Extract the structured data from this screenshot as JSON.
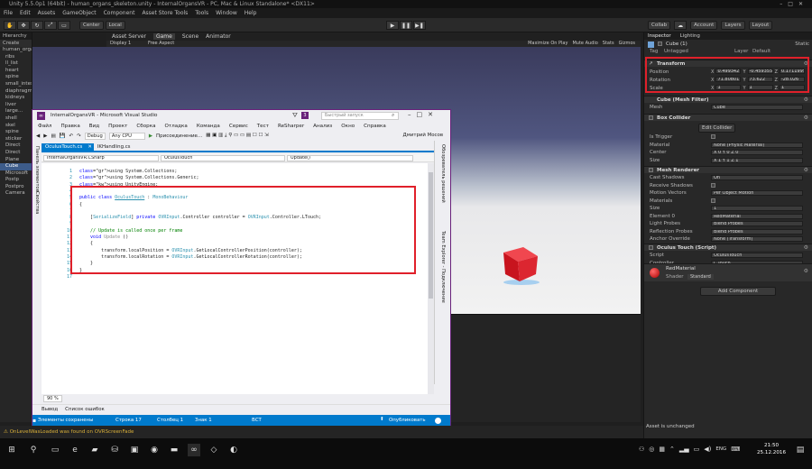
{
  "unity": {
    "title": "Unity 5.5.0p1 (64bit) - human_organs_skeleton.unity - InternalOrgansVR - PC, Mac & Linux Standalone* <DX11>",
    "menu": [
      "File",
      "Edit",
      "Assets",
      "GameObject",
      "Component",
      "Asset Store Tools",
      "Tools",
      "Window",
      "Help"
    ],
    "toolbar": {
      "pivot": "Center",
      "space": "Local",
      "collab": "Collab",
      "account": "Account",
      "layers": "Layers",
      "layout": "Layout"
    },
    "hierarchy": {
      "tab": "Hierarchy",
      "create": "Create",
      "items": [
        "human_organs_skeleton*",
        "ribs",
        "ll_list",
        "heart",
        "spine",
        "small_intestine",
        "diaphragm",
        "kidneys",
        "liver",
        "large...",
        "shell",
        "skel",
        "spine",
        "sticker",
        "Direct",
        "Direct",
        "Plane",
        "Cube",
        "Microsoft",
        "Postp",
        "Postpro",
        "Camera"
      ],
      "selected_index": 17
    },
    "scene_tabs": [
      "Asset Server",
      "Game",
      "Scene",
      "Animator"
    ],
    "scene_bar": {
      "display": "Display 1",
      "aspect": "Free Aspect",
      "right": [
        "Maximize On Play",
        "Mute Audio",
        "Stats",
        "Gizmos"
      ]
    },
    "inspector": {
      "tabs": [
        "Inspector",
        "Lighting"
      ],
      "object_name": "Cube (1)",
      "static_label": "Static",
      "tag_label": "Tag",
      "tag_value": "Untagged",
      "layer_label": "Layer",
      "layer_value": "Default",
      "transform": {
        "header": "Transform",
        "position_label": "Position",
        "position": {
          "x": "0.4993427",
          "y": "-0.4593557",
          "z": "0.1711995"
        },
        "rotation_label": "Rotation",
        "rotation": {
          "x": "71.80801",
          "y": "73.622",
          "z": "-28.026"
        },
        "scale_label": "Scale",
        "scale": {
          "x": "1",
          "y": "1",
          "z": "1"
        }
      },
      "mesh_filter": {
        "header": "Cube (Mesh Filter)",
        "mesh_label": "Mesh",
        "mesh_value": "Cube"
      },
      "box_collider": {
        "header": "Box Collider",
        "edit_button": "Edit Collider",
        "rows": [
          {
            "label": "Is Trigger",
            "value": ""
          },
          {
            "label": "Material",
            "value": "None (Physic Material)"
          },
          {
            "label": "Center",
            "value": "X 0   Y 0   Z 0"
          },
          {
            "label": "Size",
            "value": "X 1   Y 1   Z 1"
          }
        ]
      },
      "mesh_renderer": {
        "header": "Mesh Renderer",
        "rows": [
          {
            "label": "Cast Shadows",
            "value": "On"
          },
          {
            "label": "Receive Shadows",
            "value": ""
          },
          {
            "label": "Motion Vectors",
            "value": "Per Object Motion"
          },
          {
            "label": "Materials",
            "value": ""
          },
          {
            "label": "Size",
            "value": "1"
          },
          {
            "label": "Element 0",
            "value": "RedMaterial"
          },
          {
            "label": "Light Probes",
            "value": "Blend Probes"
          },
          {
            "label": "Reflection Probes",
            "value": "Blend Probes"
          },
          {
            "label": "Anchor Override",
            "value": "None (Transform)"
          }
        ]
      },
      "script": {
        "header": "Oculus Touch (Script)",
        "rows": [
          {
            "label": "Script",
            "value": "OculusTouch"
          },
          {
            "label": "Controller",
            "value": "L Touch"
          }
        ]
      },
      "material": {
        "name": "RedMaterial",
        "shader_label": "Shader",
        "shader_value": "Standard"
      },
      "add_component": "Add Component",
      "asset_status": "Asset is unchanged"
    },
    "status_warning": "OnLevelWasLoaded was found on OVRScreenFade"
  },
  "vs": {
    "title": "InternalOrgansVR - Microsoft Visual Studio",
    "notifications": "3",
    "search_placeholder": "Быстрый запуск",
    "menu": [
      "Файл",
      "Правка",
      "Вид",
      "Проект",
      "Сборка",
      "Отладка",
      "Команда",
      "Сервис",
      "Тест",
      "ReSharper",
      "Анализ",
      "Окно",
      "Справка"
    ],
    "user": "Дмитрий Мосов",
    "toolbar": {
      "config": "Debug",
      "platform": "Any CPU",
      "attach": "Присоединение..."
    },
    "tabs": [
      "OculusTouch.cs",
      "IKHandling.cs"
    ],
    "nav": [
      "InternalOrgansVR.CSharp",
      "OculusTouch",
      "Update()"
    ],
    "side_panels": [
      "Обозреватель решений",
      "Team Explorer - Подключение"
    ],
    "left_panels": [
      "Панель элементов",
      "Свойства"
    ],
    "code_lines": [
      {
        "n": "1",
        "text": "using System.Collections;"
      },
      {
        "n": "2",
        "text": "using System.Collections.Generic;"
      },
      {
        "n": "3",
        "text": "using UnityEngine;"
      },
      {
        "n": "4",
        "text": ""
      },
      {
        "n": "5",
        "text": "public class OculusTouch : MonoBehaviour"
      },
      {
        "n": "6",
        "text": "{"
      },
      {
        "n": "7",
        "text": ""
      },
      {
        "n": "8",
        "text": "    [SerializeField] private OVRInput.Controller controller = OVRInput.Controller.LTouch;"
      },
      {
        "n": "9",
        "text": ""
      },
      {
        "n": "10",
        "text": "    // Update is called once per frame"
      },
      {
        "n": "11",
        "text": "    void Update ()"
      },
      {
        "n": "12",
        "text": "    {"
      },
      {
        "n": "13",
        "text": "        transform.localPosition = OVRInput.GetLocalControllerPosition(controller);"
      },
      {
        "n": "14",
        "text": "        transform.localRotation = OVRInput.GetLocalControllerRotation(controller);"
      },
      {
        "n": "15",
        "text": "    }"
      },
      {
        "n": "16",
        "text": "}"
      },
      {
        "n": "17",
        "text": ""
      }
    ],
    "zoom": "90 %",
    "bottom_tabs": [
      "Вывод",
      "Список ошибок"
    ],
    "status": {
      "left": "Элементы сохранены",
      "line": "Строка 17",
      "col": "Столбец 1",
      "ch": "Знак 1",
      "mode": "ВСТ",
      "publish": "Опубликовать"
    }
  },
  "taskbar": {
    "time": "21:50",
    "date": "25.12.2016",
    "lang": "ENG"
  },
  "colors": {
    "annotation_red": "#e0202a",
    "vs_accent": "#007acc",
    "cube_red": "#d9232c"
  }
}
